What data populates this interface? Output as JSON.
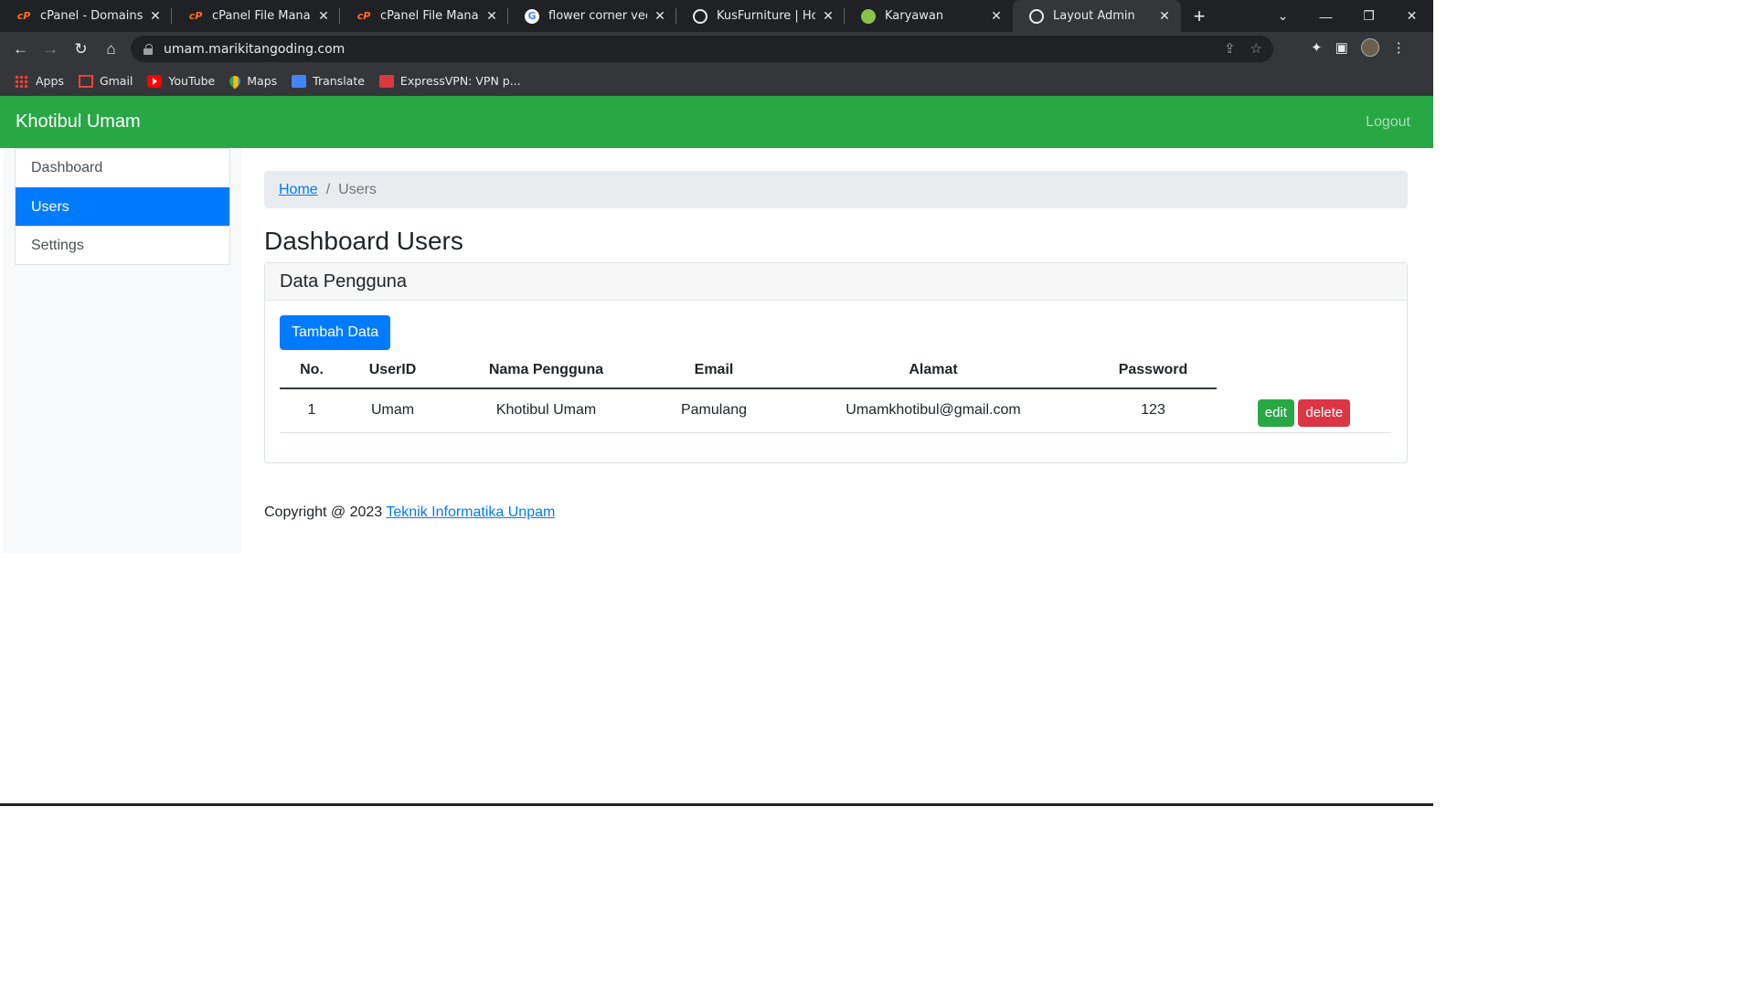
{
  "browser": {
    "tabs": [
      {
        "title": "cPanel - Domains",
        "icon": "cpanel-icon"
      },
      {
        "title": "cPanel File Manager v",
        "icon": "cpanel-icon"
      },
      {
        "title": "cPanel File Manager v",
        "icon": "cpanel-icon"
      },
      {
        "title": "flower corner vector -",
        "icon": "google-icon"
      },
      {
        "title": "KusFurniture | Homep",
        "icon": "globe-icon"
      },
      {
        "title": "Karyawan",
        "icon": "karyawan-icon"
      },
      {
        "title": "Layout Admin",
        "icon": "globe-icon"
      }
    ],
    "url": "umam.marikitangoding.com",
    "bookmarks": [
      {
        "label": "Apps",
        "icon": "apps-grid-icon"
      },
      {
        "label": "Gmail",
        "icon": "gmail-icon"
      },
      {
        "label": "YouTube",
        "icon": "youtube-icon"
      },
      {
        "label": "Maps",
        "icon": "maps-icon"
      },
      {
        "label": "Translate",
        "icon": "translate-icon"
      },
      {
        "label": "ExpressVPN: VPN p...",
        "icon": "expressvpn-icon"
      }
    ]
  },
  "navbar": {
    "brand": "Khotibul Umam",
    "logout": "Logout",
    "color": "#28a745"
  },
  "sidebar": {
    "items": [
      {
        "label": "Dashboard",
        "active": false
      },
      {
        "label": "Users",
        "active": true
      },
      {
        "label": "Settings",
        "active": false
      }
    ]
  },
  "breadcrumb": {
    "home": "Home",
    "current": "Users"
  },
  "page_title": "Dashboard Users",
  "card": {
    "header": "Data Pengguna",
    "add_button": "Tambah Data",
    "table": {
      "columns": [
        "No.",
        "UserID",
        "Nama Pengguna",
        "Email",
        "Alamat",
        "Password"
      ],
      "rows": [
        {
          "no": "1",
          "userid": "Umam",
          "nama": "Khotibul Umam",
          "email": "Pamulang",
          "alamat": "Umamkhotibul@gmail.com",
          "password": "123",
          "edit": "edit",
          "delete": "delete"
        }
      ]
    }
  },
  "footer": {
    "text": "Copyright @ 2023",
    "link": "Teknik Informatika Unpam"
  }
}
